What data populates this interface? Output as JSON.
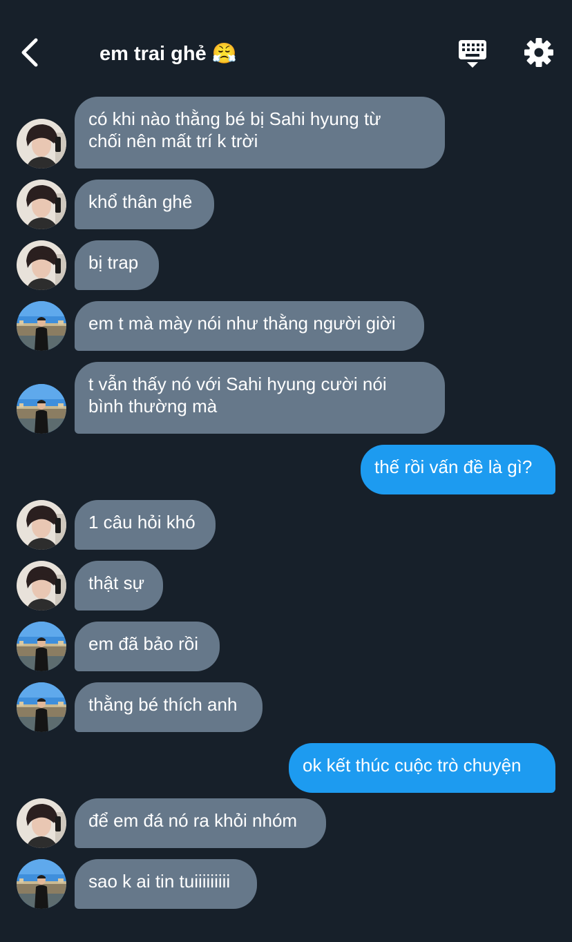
{
  "header": {
    "title": "em trai ghẻ 😤",
    "back_icon": "chevron-left-icon",
    "keyboard_icon": "keyboard-icon",
    "settings_icon": "gear-icon"
  },
  "colors": {
    "background": "#17202a",
    "incoming_bubble": "#66788a",
    "outgoing_bubble": "#1d9bf0",
    "text": "#ffffff"
  },
  "messages": [
    {
      "side": "in",
      "avatar": "avatar-a",
      "lines": [
        "có khi nào thằng bé bị Sahi hyung từ",
        "chối nên mất trí k trời"
      ]
    },
    {
      "side": "in",
      "avatar": "avatar-a",
      "lines": [
        "khổ thân ghê"
      ]
    },
    {
      "side": "in",
      "avatar": "avatar-a",
      "lines": [
        "bị trap"
      ]
    },
    {
      "side": "in",
      "avatar": "avatar-b",
      "lines": [
        "em t mà mày nói như thằng người giời"
      ]
    },
    {
      "side": "in",
      "avatar": "avatar-b",
      "lines": [
        "t vẫn thấy nó với Sahi hyung cười nói",
        "bình thường mà"
      ]
    },
    {
      "side": "out",
      "lines": [
        "thế rồi vấn đề là gì?"
      ]
    },
    {
      "side": "in",
      "avatar": "avatar-a",
      "lines": [
        "1 câu hỏi khó"
      ]
    },
    {
      "side": "in",
      "avatar": "avatar-a",
      "lines": [
        "thật sự"
      ]
    },
    {
      "side": "in",
      "avatar": "avatar-b",
      "lines": [
        "em đã bảo rồi"
      ]
    },
    {
      "side": "in",
      "avatar": "avatar-b",
      "lines": [
        "thằng bé thích anh"
      ]
    },
    {
      "side": "out",
      "lines": [
        "ok kết thúc cuộc trò chuyện"
      ]
    },
    {
      "side": "in",
      "avatar": "avatar-a",
      "lines": [
        "để em đá nó ra khỏi nhóm"
      ]
    },
    {
      "side": "in",
      "avatar": "avatar-b",
      "lines": [
        "sao k ai tin tuiiiiiiiii"
      ]
    }
  ]
}
